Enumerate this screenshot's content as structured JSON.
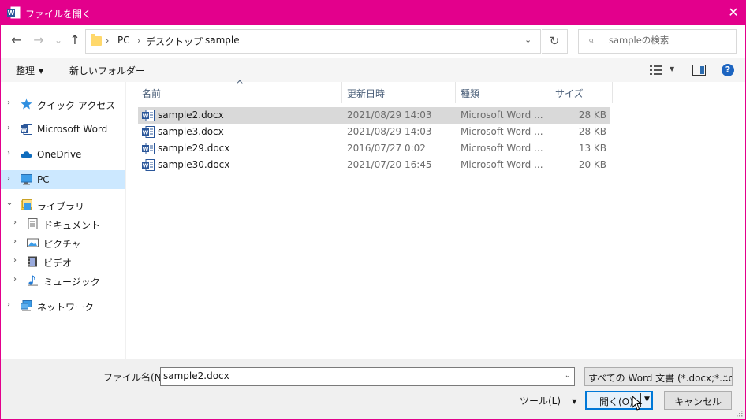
{
  "window": {
    "title": "ファイルを開く",
    "accent_color": "#e3008c",
    "app_icon": "word-app-icon",
    "close_symbol": "✕"
  },
  "nav": {
    "back_icon": "←",
    "forward_icon": "→",
    "recent_icon": "⌄",
    "up_icon": "↑"
  },
  "address": {
    "breadcrumbs": [
      "PC",
      "デスクトップ",
      "sample"
    ],
    "separator": "›",
    "refresh_icon": "↻"
  },
  "search": {
    "placeholder": "sampleの検索",
    "icon": "⌕"
  },
  "toolbar": {
    "organize": "整理",
    "new_folder": "新しいフォルダー",
    "dropdown_arrow": "▼",
    "help": "?"
  },
  "sidebar": {
    "items": [
      {
        "label": "クイック アクセス",
        "icon": "star-icon"
      },
      {
        "label": "Microsoft Word",
        "icon": "word-icon"
      },
      {
        "label": "OneDrive",
        "icon": "cloud-icon"
      },
      {
        "label": "PC",
        "icon": "computer-icon",
        "selected": true
      },
      {
        "label": "ライブラリ",
        "icon": "library-icon",
        "expanded": true
      },
      {
        "label": "ドキュメント",
        "icon": "document-icon"
      },
      {
        "label": "ピクチャ",
        "icon": "picture-icon"
      },
      {
        "label": "ビデオ",
        "icon": "video-icon"
      },
      {
        "label": "ミュージック",
        "icon": "music-icon"
      },
      {
        "label": "ネットワーク",
        "icon": "network-icon"
      }
    ],
    "chevron_collapsed": "›",
    "chevron_expanded": "⌄"
  },
  "columns": {
    "name": "名前",
    "date": "更新日時",
    "type": "種類",
    "size": "サイズ",
    "sort_indicator": "^"
  },
  "files": [
    {
      "name": "sample2.docx",
      "date": "2021/08/29 14:03",
      "type": "Microsoft Word ...",
      "size": "28 KB",
      "selected": true
    },
    {
      "name": "sample3.docx",
      "date": "2021/08/29 14:03",
      "type": "Microsoft Word ...",
      "size": "28 KB"
    },
    {
      "name": "sample29.docx",
      "date": "2016/07/27 0:02",
      "type": "Microsoft Word ...",
      "size": "13 KB"
    },
    {
      "name": "sample30.docx",
      "date": "2021/07/20 16:45",
      "type": "Microsoft Word ...",
      "size": "20 KB"
    }
  ],
  "footer": {
    "filename_label": "ファイル名(N):",
    "filename_value": "sample2.docx",
    "filter": "すべての Word 文書 (*.docx;*.do",
    "tools": "ツール(L)",
    "open": "開く(O)",
    "cancel": "キャンセル",
    "dropdown_arrow": "⌄",
    "split_arrow": "▼"
  }
}
